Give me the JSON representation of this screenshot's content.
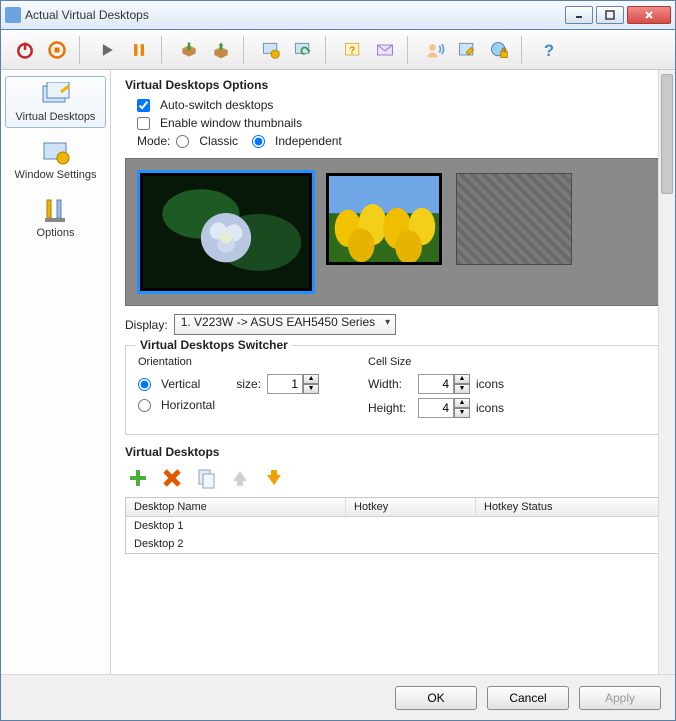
{
  "window": {
    "title": "Actual Virtual Desktops"
  },
  "sidebar": {
    "items": [
      {
        "label": "Virtual Desktops",
        "selected": true
      },
      {
        "label": "Window Settings",
        "selected": false
      },
      {
        "label": "Options",
        "selected": false
      }
    ]
  },
  "options": {
    "heading": "Virtual Desktops Options",
    "auto_switch_label": "Auto-switch desktops",
    "auto_switch_checked": true,
    "enable_thumbs_label": "Enable window thumbnails",
    "enable_thumbs_checked": false,
    "mode_label": "Mode:",
    "mode_classic_label": "Classic",
    "mode_independent_label": "Independent",
    "mode_value": "Independent"
  },
  "display": {
    "label": "Display:",
    "selected": "1. V223W -> ASUS EAH5450 Series"
  },
  "switcher": {
    "heading": "Virtual Desktops Switcher",
    "orientation_label": "Orientation",
    "vertical_label": "Vertical",
    "horizontal_label": "Horizontal",
    "orientation_value": "Vertical",
    "size_label": "size:",
    "size_value": "1",
    "cellsize_label": "Cell Size",
    "width_label": "Width:",
    "width_value": "4",
    "height_label": "Height:",
    "height_value": "4",
    "icons_suffix": "icons"
  },
  "desktops": {
    "heading": "Virtual Desktops",
    "columns": [
      "Desktop Name",
      "Hotkey",
      "Hotkey Status"
    ],
    "rows": [
      {
        "name": "Desktop 1",
        "hotkey": "",
        "status": ""
      },
      {
        "name": "Desktop 2",
        "hotkey": "",
        "status": ""
      }
    ]
  },
  "footer": {
    "ok": "OK",
    "cancel": "Cancel",
    "apply": "Apply"
  },
  "toolbar_icons": [
    "power",
    "stop",
    "play",
    "pause",
    "box-in",
    "box-out",
    "window-gear",
    "window-refresh",
    "help-window",
    "mail",
    "user-sound",
    "edit-window",
    "globe-lock",
    "help"
  ]
}
